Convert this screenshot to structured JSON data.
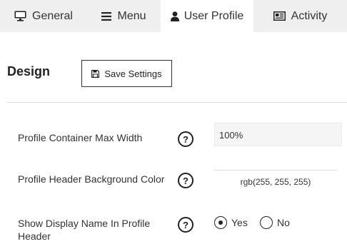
{
  "tabs": [
    {
      "label": "General",
      "icon": "monitor-icon"
    },
    {
      "label": "Menu",
      "icon": "hamburger-menu-icon"
    },
    {
      "label": "User Profile",
      "icon": "user-icon"
    },
    {
      "label": "Activity",
      "icon": "newspaper-icon"
    }
  ],
  "active_tab": "User Profile",
  "section": {
    "title": "Design",
    "save_label": "Save Settings",
    "save_icon": "floppy-disk-icon"
  },
  "settings": {
    "max_width": {
      "label": "Profile Container Max Width",
      "value": "100%",
      "help": "?"
    },
    "header_bg": {
      "label": "Profile Header Background Color",
      "value": "rgb(255, 255, 255)",
      "help": "?"
    },
    "show_name": {
      "label_line1": "Show Display Name In Profile",
      "label_line2": "Header",
      "help": "?",
      "options": [
        {
          "label": "Yes",
          "selected": true
        },
        {
          "label": "No",
          "selected": false
        }
      ]
    }
  }
}
